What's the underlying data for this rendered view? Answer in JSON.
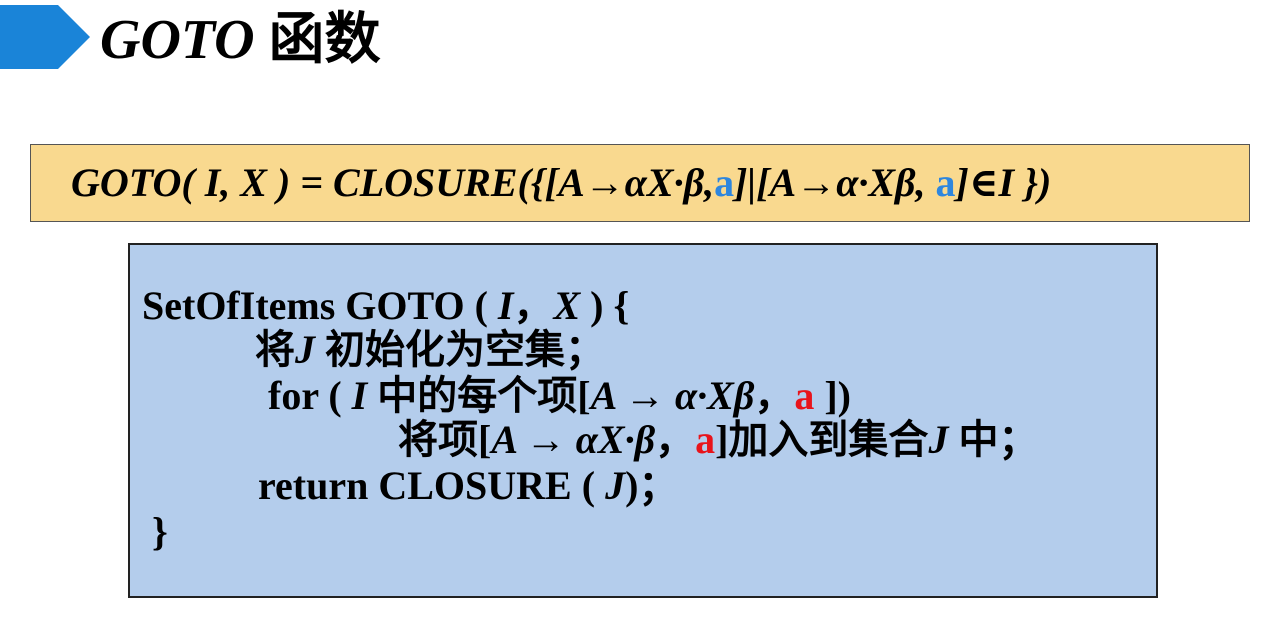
{
  "colors": {
    "chevron": "#1a84d8",
    "formula_box": "#f9d98f",
    "code_box": "#b4cdec",
    "blue_a": "#2e86de",
    "red_a": "#e8141b"
  },
  "title": {
    "goto": "GOTO",
    "rest": "函数"
  },
  "formula": {
    "lhs": "GOTO( I, X ) = CLOSURE({[A→αX·β,",
    "a1": "a",
    "middle": "]|[A→α·Xβ, ",
    "a2": "a",
    "rhs": "]∈I })"
  },
  "code": {
    "l1_a": "SetOfItems GOTO (",
    "l1_i": "I",
    "l1_comma": "，",
    "l1_x": "X",
    "l1_b": ") {",
    "l2_a": "将",
    "l2_j": "J",
    "l2_b": " 初始化为空集；",
    "l3_a": "for (",
    "l3_i": "I",
    "l3_b": " 中的每个项[",
    "l3_item": "A → α·Xβ",
    "l3_comma": "，",
    "l3_la": "a",
    "l3_c": " ])",
    "l4_a": "将项[",
    "l4_item": "A → αX·β",
    "l4_comma": "，",
    "l4_la": "a",
    "l4_b": "]加入到集合",
    "l4_j": "J",
    "l4_c": " 中；",
    "l5_a": "return CLOSURE (",
    "l5_j": "J",
    "l5_b": ")；",
    "l6": "}"
  }
}
